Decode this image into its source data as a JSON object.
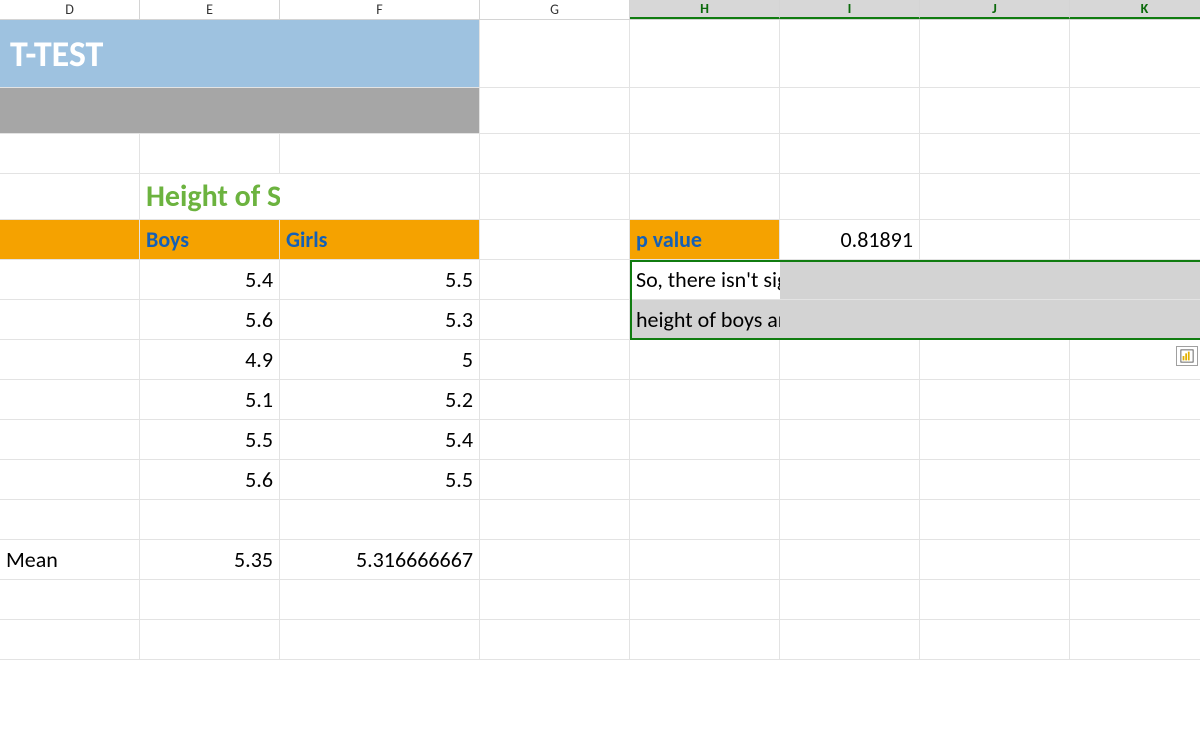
{
  "columns": [
    "D",
    "E",
    "F",
    "G",
    "H",
    "I",
    "J",
    "K"
  ],
  "selected_columns": [
    "H",
    "I",
    "J",
    "K"
  ],
  "title": "T-TEST",
  "section_title": "Height of Students (In)",
  "sub_headers": {
    "boys": "Boys",
    "girls": "Girls"
  },
  "data": {
    "boys": [
      "5.4",
      "5.6",
      "4.9",
      "5.1",
      "5.5",
      "5.6"
    ],
    "girls": [
      "5.5",
      "5.3",
      "5",
      "5.2",
      "5.4",
      "5.5"
    ]
  },
  "mean": {
    "label": "Mean",
    "boys": "5.35",
    "girls": "5.316666667"
  },
  "pvalue": {
    "label": "p value",
    "value": "0.81891"
  },
  "explanation_line1": "So, there isn't significance between",
  "explanation_line2": "height of boys and girls"
}
